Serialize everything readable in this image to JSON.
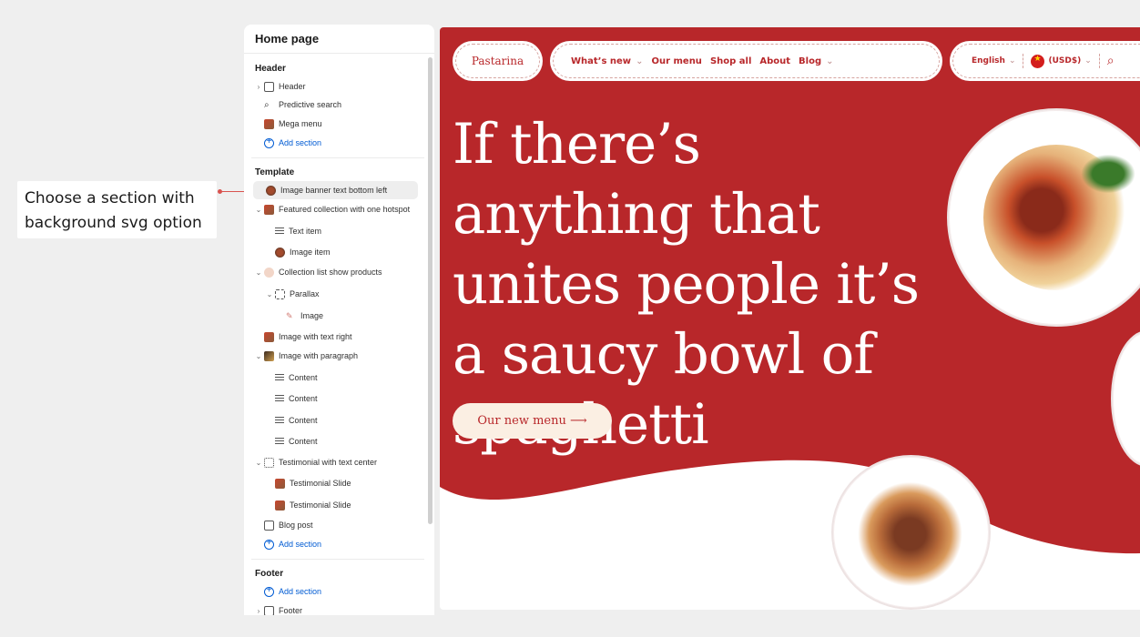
{
  "callout": {
    "text_line1": "Choose a section with",
    "text_line2": "background svg option"
  },
  "sidebar": {
    "title": "Home page",
    "groups": {
      "header": "Header",
      "template": "Template",
      "footer": "Footer"
    },
    "header_items": [
      "Header",
      "Predictive search",
      "Mega menu"
    ],
    "add_section": "Add section",
    "template_items": [
      "Image banner text bottom left",
      "Featured collection with one hotspot",
      "Text item",
      "Image item",
      "Collection list show products",
      "Parallax",
      "Image",
      "Image with text right",
      "Image with paragraph",
      "Content",
      "Content",
      "Content",
      "Content",
      "Testimonial with text center",
      "Testimonial Slide",
      "Testimonial Slide",
      "Blog post"
    ],
    "footer_items": [
      "Footer"
    ]
  },
  "preview": {
    "logo": "Pastarina",
    "nav": [
      "What’s new",
      "Our menu",
      "Shop all",
      "About",
      "Blog"
    ],
    "language": "English",
    "currency": "(USD$)",
    "headline": "If there’s anything that unites people it’s a saucy bowl of spaghetti",
    "cta": "Our new menu ⟶",
    "colors": {
      "brand_red": "#b8272a",
      "cta_bg": "#fbefe3",
      "accent_blue": "#005bd3"
    }
  }
}
